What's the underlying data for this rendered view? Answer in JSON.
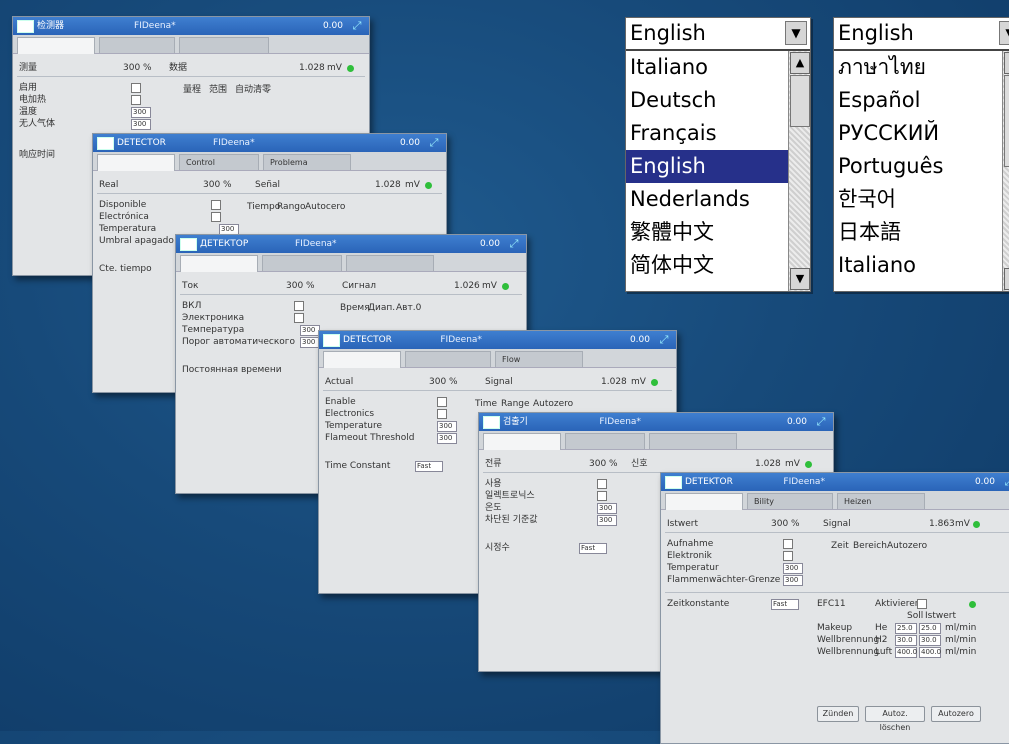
{
  "colors": {
    "background": "#174a7a",
    "titlebar": "#2a64b8",
    "selection": "#26308a",
    "status_led": "#2fbf3b"
  },
  "language_list_1": {
    "selected": "English",
    "options": [
      "Italiano",
      "Deutsch",
      "Français",
      "English",
      "Nederlands",
      "繁體中文",
      "简体中文"
    ],
    "highlighted": "English"
  },
  "language_list_2": {
    "selected": "English",
    "options": [
      "ภาษาไทย",
      "Español",
      "РУССКИЙ",
      "Português",
      "한국어",
      "日本語",
      "Italiano"
    ]
  },
  "windows": [
    {
      "app": "检测器",
      "project": "FIDeena*",
      "readout": "0.00",
      "tabs": [
        "",
        "",
        ""
      ],
      "header": {
        "left": "测量",
        "value": "300",
        "unit": "%",
        "mid": "数据",
        "right": "1.028",
        "right_unit": "mV"
      },
      "rows": [
        "启用",
        "电加热",
        "温度",
        "无人气体"
      ],
      "fields": [
        "300",
        "300"
      ],
      "lower": "响应时间",
      "group": [
        "量程",
        "范围",
        "自动清零"
      ]
    },
    {
      "app": "DETECTOR",
      "project": "FIDeena*",
      "readout": "0.00",
      "tabs": [
        "",
        "Control",
        "Problema"
      ],
      "header": {
        "left": "Real",
        "value": "300",
        "unit": "%",
        "mid": "Señal",
        "right": "1.028",
        "right_unit": "mV"
      },
      "rows": [
        "Disponible",
        "Electrónica",
        "Temperatura",
        "Umbral apagado"
      ],
      "fields": [
        "300"
      ],
      "lower": "Cte. tiempo",
      "group": [
        "Tiempo",
        "Rango",
        "Autocero"
      ]
    },
    {
      "app": "ДЕТЕКТОР",
      "project": "FIDeena*",
      "readout": "0.00",
      "tabs": [
        "",
        "",
        ""
      ],
      "header": {
        "left": "Ток",
        "value": "300",
        "unit": "%",
        "mid": "Сигнал",
        "right": "1.026",
        "right_unit": "mV"
      },
      "rows": [
        "ВКЛ",
        "Электроника",
        "Температура",
        "Порог автоматического"
      ],
      "fields": [
        "300",
        "300"
      ],
      "lower": "Постоянная времени",
      "group": [
        "Время",
        "Диап.",
        "Авт.0"
      ]
    },
    {
      "app": "DETECTOR",
      "project": "FIDeena*",
      "readout": "0.00",
      "tabs": [
        "",
        "",
        "Flow"
      ],
      "header": {
        "left": "Actual",
        "value": "300",
        "unit": "%",
        "mid": "Signal",
        "right": "1.028",
        "right_unit": "mV"
      },
      "rows": [
        "Enable",
        "Electronics",
        "Temperature",
        "Flameout Threshold"
      ],
      "fields": [
        "300",
        "300"
      ],
      "lower": "Time Constant",
      "lower_value": "Fast",
      "group": [
        "Time",
        "Range",
        "Autozero"
      ]
    },
    {
      "app": "검출기",
      "project": "FIDeena*",
      "readout": "0.00",
      "tabs": [
        "",
        "",
        ""
      ],
      "header": {
        "left": "전류",
        "value": "300",
        "unit": "%",
        "mid": "신호",
        "right": "1.028",
        "right_unit": "mV"
      },
      "rows": [
        "사용",
        "일렉트로닉스",
        "온도",
        "차단된 기준값"
      ],
      "fields": [
        "300",
        "300"
      ],
      "lower": "시정수",
      "lower_value": "Fast"
    },
    {
      "app": "DETEKTOR",
      "project": "FIDeena*",
      "readout": "0.00",
      "tabs": [
        "",
        "Bility",
        "Heizen"
      ],
      "header": {
        "left": "Istwert",
        "value": "300",
        "unit": "%",
        "mid": "Signal",
        "right": "1.863",
        "right_unit": "mV"
      },
      "rows": [
        "Aufnahme",
        "Elektronik",
        "Temperatur",
        "Flammenwächter-Grenze"
      ],
      "fields": [
        "300",
        "300"
      ],
      "lower": "Zeitkonstante",
      "lower_value": "Fast",
      "group": [
        "Zeit",
        "Bereich",
        "Autozero"
      ],
      "efc": {
        "title": "EFC11",
        "mode": "Aktivieren",
        "col_soll": "Soll",
        "col_ist": "Istwert",
        "gases": [
          {
            "name": "Makeup",
            "sym": "He",
            "soll": "25.0",
            "ist": "25.0",
            "unit": "ml/min"
          },
          {
            "name": "Wellbrennung",
            "sym": "H2",
            "soll": "30.0",
            "ist": "30.0",
            "unit": "ml/min"
          },
          {
            "name": "Wellbrennung",
            "sym": "Luft",
            "soll": "400.0",
            "ist": "400.0",
            "unit": "ml/min"
          }
        ]
      },
      "buttons": [
        "Zünden",
        "Autoz. löschen",
        "Autozero"
      ]
    }
  ]
}
